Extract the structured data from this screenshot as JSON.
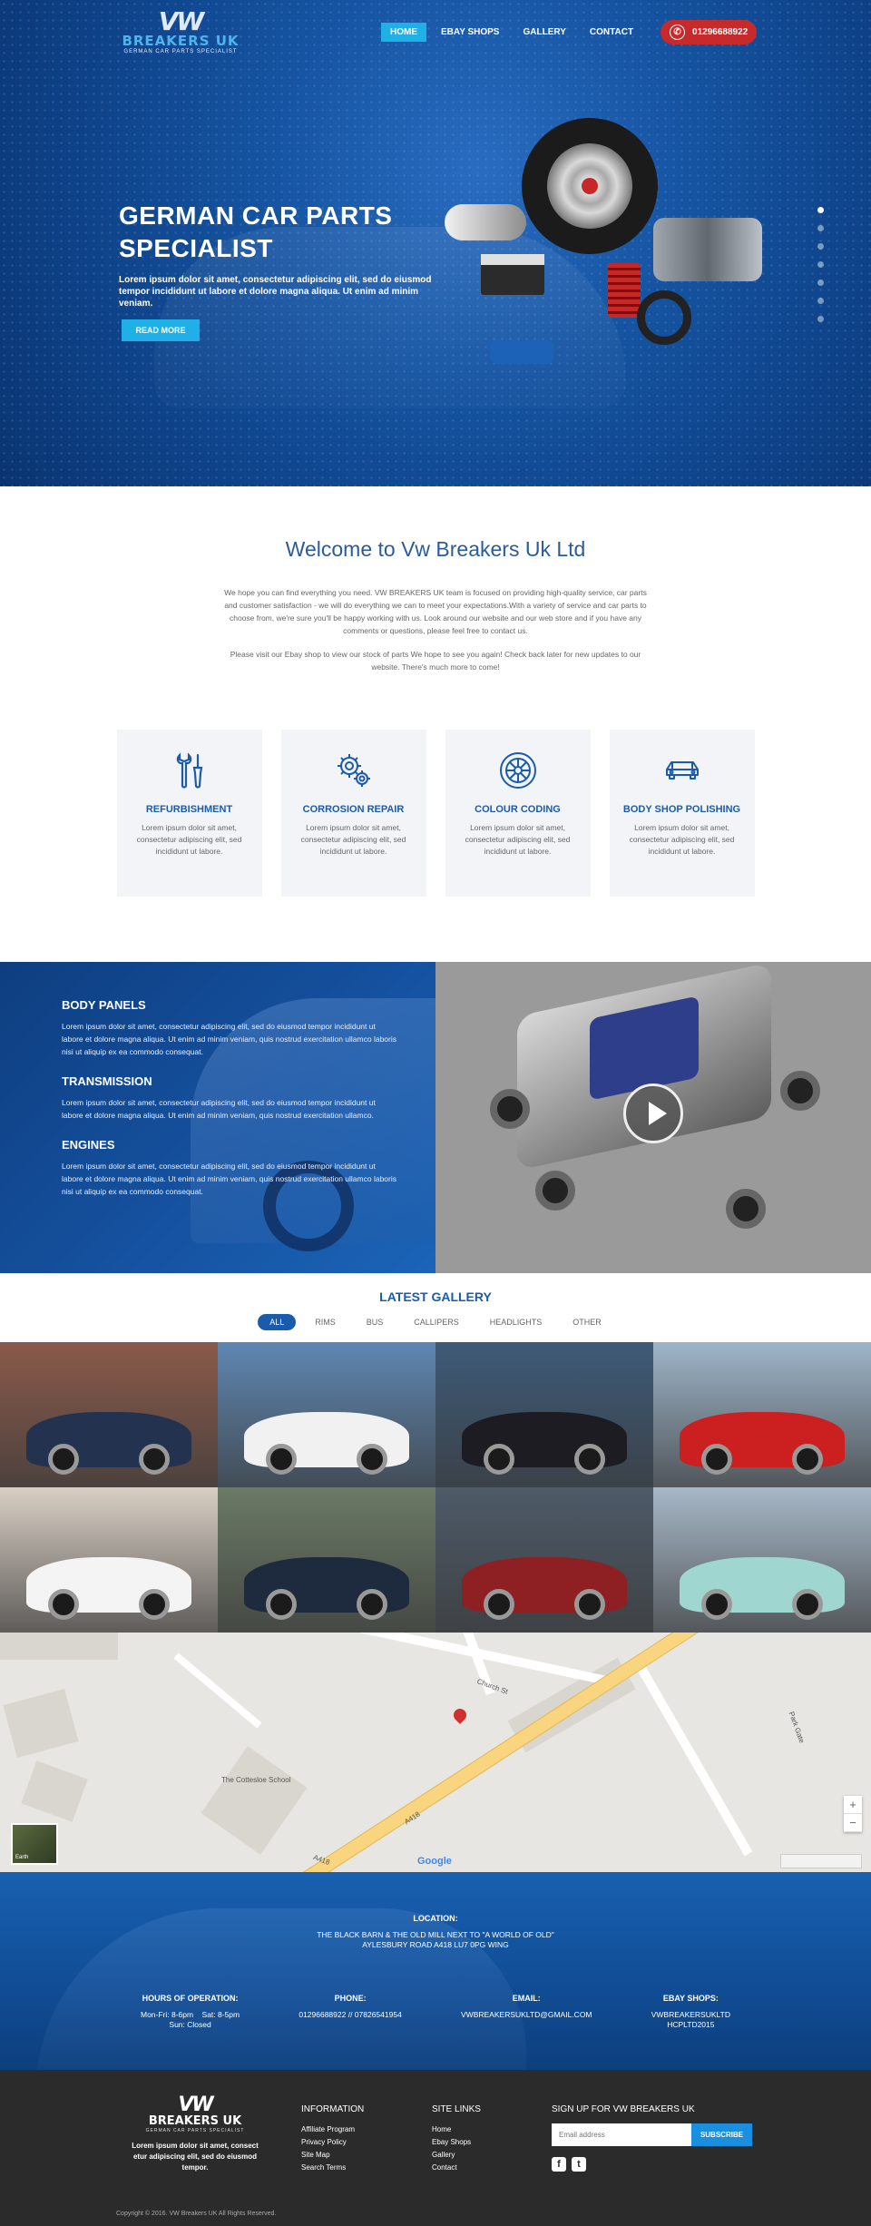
{
  "logo": {
    "mark": "VW",
    "word": "BREAKERS UK",
    "tagline": "GERMAN CAR PARTS SPECIALIST"
  },
  "nav": {
    "items": [
      "HOME",
      "EBAY SHOPS",
      "GALLERY",
      "CONTACT"
    ],
    "active": "HOME",
    "phone": "01296688922"
  },
  "hero": {
    "title": "GERMAN CAR PARTS SPECIALIST",
    "text": "Lorem ipsum dolor sit amet, consectetur adipiscing elit, sed do eiusmod tempor incididunt ut labore et dolore magna aliqua. Ut enim ad minim veniam.",
    "button": "READ MORE",
    "slide_count": 7,
    "active_slide": 1
  },
  "welcome": {
    "title": "Welcome to Vw Breakers Uk Ltd",
    "para1": "We hope you can find everything you need. VW BREAKERS UK team is focused on providing high-quality service, car parts and customer satisfaction - we will do everything we can to meet your expectations.With a variety of service and car parts to choose from, we're sure you'll be happy working with us. Look around our website and our web store and if you have any comments or questions, please feel free to contact us.",
    "para2": "Please visit our Ebay shop to view our stock of parts We hope to see you again! Check back later for new updates to our website. There's much more to come!"
  },
  "features": [
    {
      "icon": "tools-icon",
      "title": "REFURBISHMENT",
      "text": "Lorem ipsum dolor sit amet, consectetur adipiscing elit, sed incididunt ut labore."
    },
    {
      "icon": "gears-icon",
      "title": "CORROSION REPAIR",
      "text": "Lorem ipsum dolor sit amet, consectetur adipiscing elit, sed incididunt ut labore."
    },
    {
      "icon": "wheel-icon",
      "title": "COLOUR CODING",
      "text": "Lorem ipsum dolor sit amet, consectetur adipiscing elit, sed incididunt ut labore."
    },
    {
      "icon": "car-icon",
      "title": "BODY SHOP POLISHING",
      "text": "Lorem ipsum dolor sit amet, consectetur adipiscing elit, sed incididunt ut labore."
    }
  ],
  "services": [
    {
      "title": "BODY PANELS",
      "text": "Lorem ipsum dolor sit amet, consectetur adipiscing elit, sed do eiusmod tempor incididunt ut labore et dolore magna aliqua. Ut enim ad minim veniam, quis nostrud exercitation ullamco laboris nisi ut aliquip ex ea commodo consequat."
    },
    {
      "title": "TRANSMISSION",
      "text": "Lorem ipsum dolor sit amet, consectetur adipiscing elit, sed do eiusmod tempor incididunt ut labore et dolore magna aliqua. Ut enim ad minim veniam, quis nostrud exercitation ullamco."
    },
    {
      "title": "ENGINES",
      "text": "Lorem ipsum dolor sit amet, consectetur adipiscing elit, sed do eiusmod tempor incididunt ut labore et dolore magna aliqua. Ut enim ad minim veniam, quis nostrud exercitation ullamco laboris nisi ut aliquip ex ea commodo consequat."
    }
  ],
  "gallery": {
    "title": "LATEST GALLERY",
    "filters": [
      "ALL",
      "RIMS",
      "BUS",
      "CALLIPERS",
      "HEADLIGHTS",
      "OTHER"
    ],
    "active_filter": "ALL",
    "tiles": [
      {
        "bg": "#8a5a4a",
        "car": "#22324f"
      },
      {
        "bg": "#5f87b2",
        "car": "#f1f1f1"
      },
      {
        "bg": "#3e5a78",
        "car": "#1c1c22"
      },
      {
        "bg": "#9eb5c9",
        "car": "#cc1f1f"
      },
      {
        "bg": "#d9cfc4",
        "car": "#f4f4f4"
      },
      {
        "bg": "#6b7a66",
        "car": "#1e2a3e"
      },
      {
        "bg": "#4d5a68",
        "car": "#8e1f22"
      },
      {
        "bg": "#a7b8c8",
        "car": "#9fd6cf"
      }
    ]
  },
  "map": {
    "labels": {
      "school": "The Cottesloe School",
      "road_a418_1": "A418",
      "road_a418_2": "A418",
      "church": "Church St",
      "park_gate": "Park Gate",
      "earth": "Earth"
    },
    "brand": "Google"
  },
  "contact": {
    "location_label": "LOCATION:",
    "address_line1": "THE BLACK BARN & THE OLD MILL NEXT TO \"A WORLD OF OLD\"",
    "address_line2": "AYLESBURY ROAD A418 LU7 0PG WING",
    "hours_label": "HOURS OF OPERATION:",
    "hours_line1": "Mon-Fri: 8-6pm    Sat: 8-5pm",
    "hours_line2": "Sun: Closed",
    "phone_label": "PHONE:",
    "phone_value": "01296688922 // 07826541954",
    "email_label": "EMAIL:",
    "email_value": "VWBREAKERSUKLTD@GMAIL.COM",
    "ebay_label": "EBAY SHOPS:",
    "ebay_line1": "VWBREAKERSUKLTD",
    "ebay_line2": "HCPLTD2015"
  },
  "footer": {
    "about": "Lorem ipsum dolor sit amet, consect etur adipiscing elit, sed do eiusmod tempor.",
    "info_title": "INFORMATION",
    "info_links": [
      "Affiliate Program",
      "Privacy Policy",
      "Site Map",
      "Search Terms"
    ],
    "site_title": "SITE LINKS",
    "site_links": [
      "Home",
      "Ebay Shops",
      "Gallery",
      "Contact"
    ],
    "signup_title": "SIGN UP FOR VW BREAKERS UK",
    "email_placeholder": "Email address",
    "subscribe": "SUBSCRIBE",
    "social": {
      "facebook": "f",
      "twitter": "t"
    },
    "copyright": "Copyright © 2016. VW Breakers UK All Rights Reserved."
  }
}
